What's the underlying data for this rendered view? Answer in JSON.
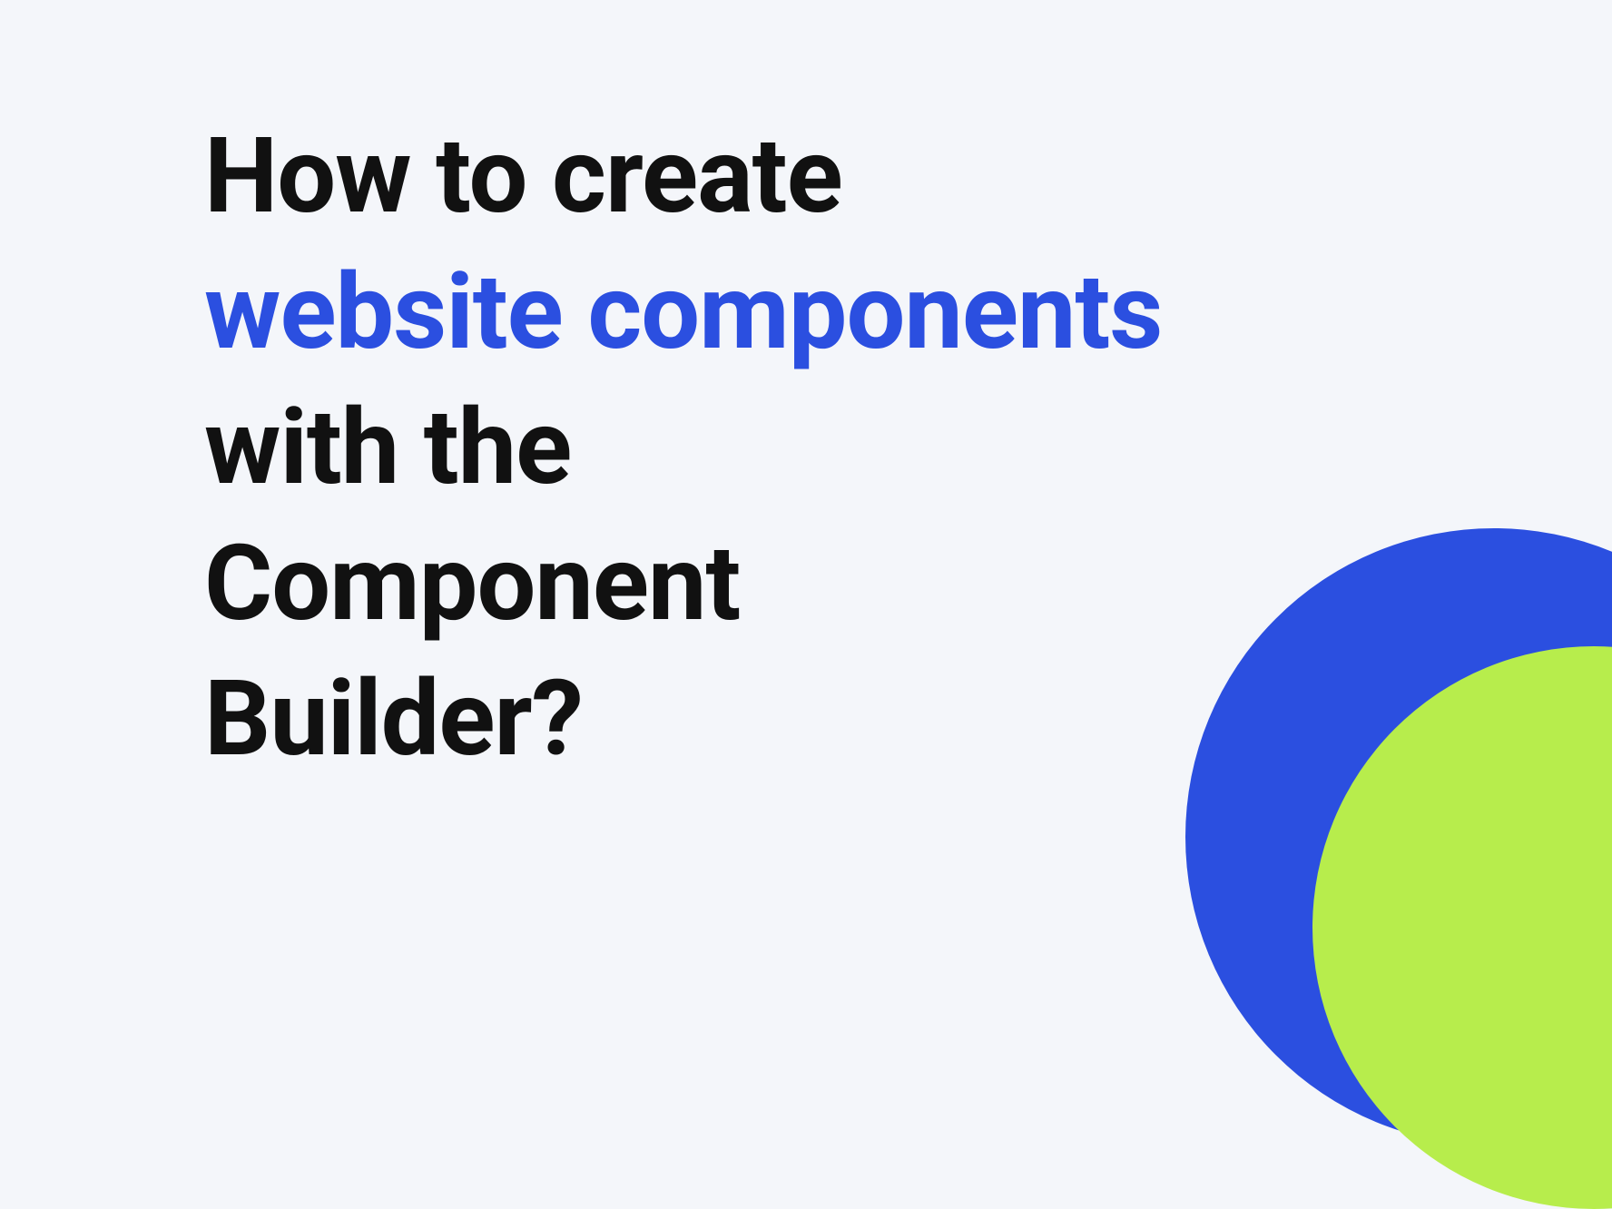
{
  "heading": {
    "line1": "How to create",
    "highlight": "website components",
    "line3": "with the",
    "line4": "Component",
    "line5": "Builder?"
  },
  "colors": {
    "background": "#f4f6fa",
    "text": "#111111",
    "highlight": "#2b4fe0",
    "circleBlue": "#2b4fe0",
    "circleGreen": "#b7ed4c"
  }
}
